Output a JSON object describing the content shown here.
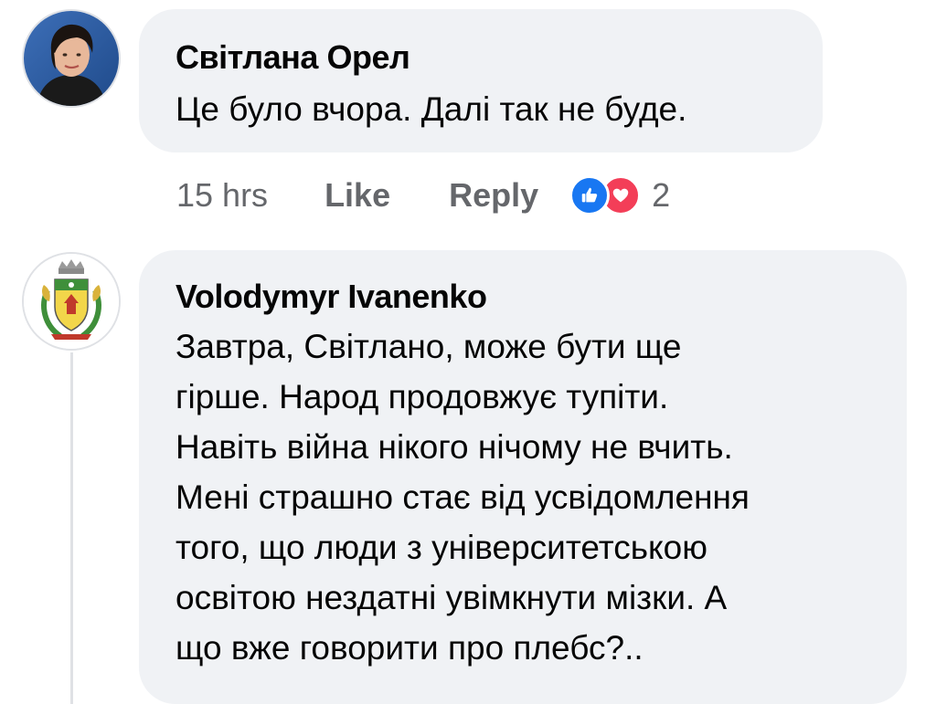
{
  "comments": [
    {
      "author": "Світлана Орел",
      "text": "Це було вчора. Далі так не буде.",
      "time": "15 hrs",
      "like_label": "Like",
      "reply_label": "Reply",
      "reaction_count": "2",
      "reactions": [
        "like",
        "love"
      ]
    },
    {
      "author": "Volodymyr Ivanenko",
      "text": "Завтра, Світлано, може бути ще\nгірше. Народ продовжує тупіти.\nНавіть війна нікого нічому не вчить.\nМені страшно стає від усвідомлення\nтого, що люди з університетською\nосвітою нездатні увімкнути мізки. А\nщо вже говорити про плебс?.."
    }
  ],
  "colors": {
    "bubble": "#f0f2f5",
    "text": "#050505",
    "meta": "#65676b",
    "like_blue": "#1877f2",
    "love_red": "#f33e58"
  }
}
